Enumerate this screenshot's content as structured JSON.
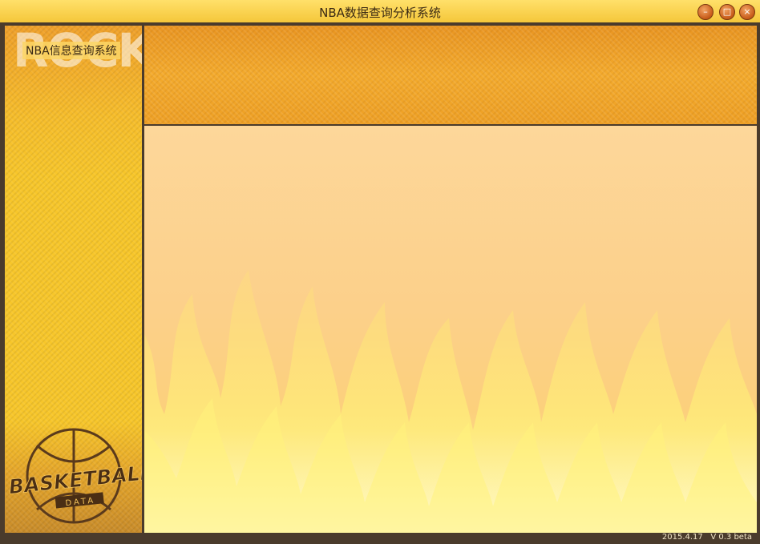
{
  "window": {
    "title": "NBA数据查询分析系统",
    "controls": {
      "minimize_icon": "–",
      "maximize_icon": "□",
      "close_icon": "×"
    }
  },
  "sidebar": {
    "background_text": "ROCK",
    "system_label": "NBA信息查询系统",
    "logo": {
      "main_text": "BASKETBALL",
      "sub_text": "DATA"
    }
  },
  "status": {
    "date": "2015.4.17",
    "version": "V 0.3 beta"
  },
  "colors": {
    "frame": "#4a3b2c",
    "titlebar": "#f5c73a",
    "sidebar": "#f7c62a",
    "header": "#f3aa2c",
    "main_panel": "#fcd08a",
    "flame": "#ffee70"
  }
}
